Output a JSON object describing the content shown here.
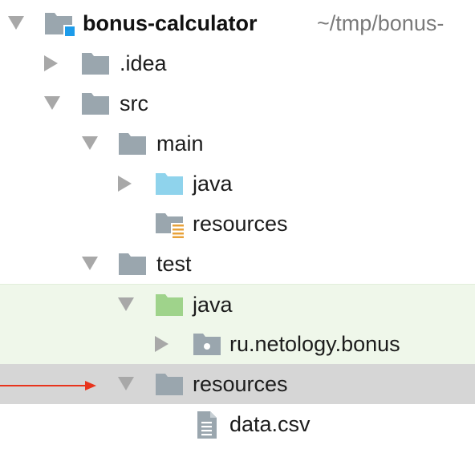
{
  "colors": {
    "folder_gray": "#9aa6ae",
    "source_blue": "#8fd3ec",
    "test_green": "#9fd38b",
    "resource_orange": "#e8a23a",
    "project_badge_blue": "#1c9bea",
    "selection_gray": "#d6d6d6",
    "test_row_bg": "#eff7ea",
    "arrow_red": "#e8341c"
  },
  "tree": {
    "root": {
      "label": "bonus-calculator",
      "path": "~/tmp/bonus-",
      "expanded": true,
      "icon": "project-folder-icon"
    },
    "items": [
      {
        "label": ".idea",
        "expanded": false,
        "icon": "folder-icon"
      },
      {
        "label": "src",
        "expanded": true,
        "icon": "folder-icon"
      },
      {
        "label": "main",
        "expanded": true,
        "icon": "folder-icon"
      },
      {
        "label": "java",
        "expanded": false,
        "icon": "source-root-folder-icon"
      },
      {
        "label": "resources",
        "icon": "resources-root-folder-icon"
      },
      {
        "label": "test",
        "expanded": true,
        "icon": "folder-icon"
      },
      {
        "label": "java",
        "expanded": true,
        "icon": "test-source-root-folder-icon"
      },
      {
        "label": "ru.netology.bonus",
        "expanded": false,
        "icon": "package-icon"
      },
      {
        "label": "resources",
        "expanded": true,
        "selected": true,
        "icon": "folder-icon"
      },
      {
        "label": "data.csv",
        "icon": "text-file-icon"
      }
    ]
  },
  "annotation": {
    "icon": "red-arrow-icon",
    "points_to": "resources"
  }
}
